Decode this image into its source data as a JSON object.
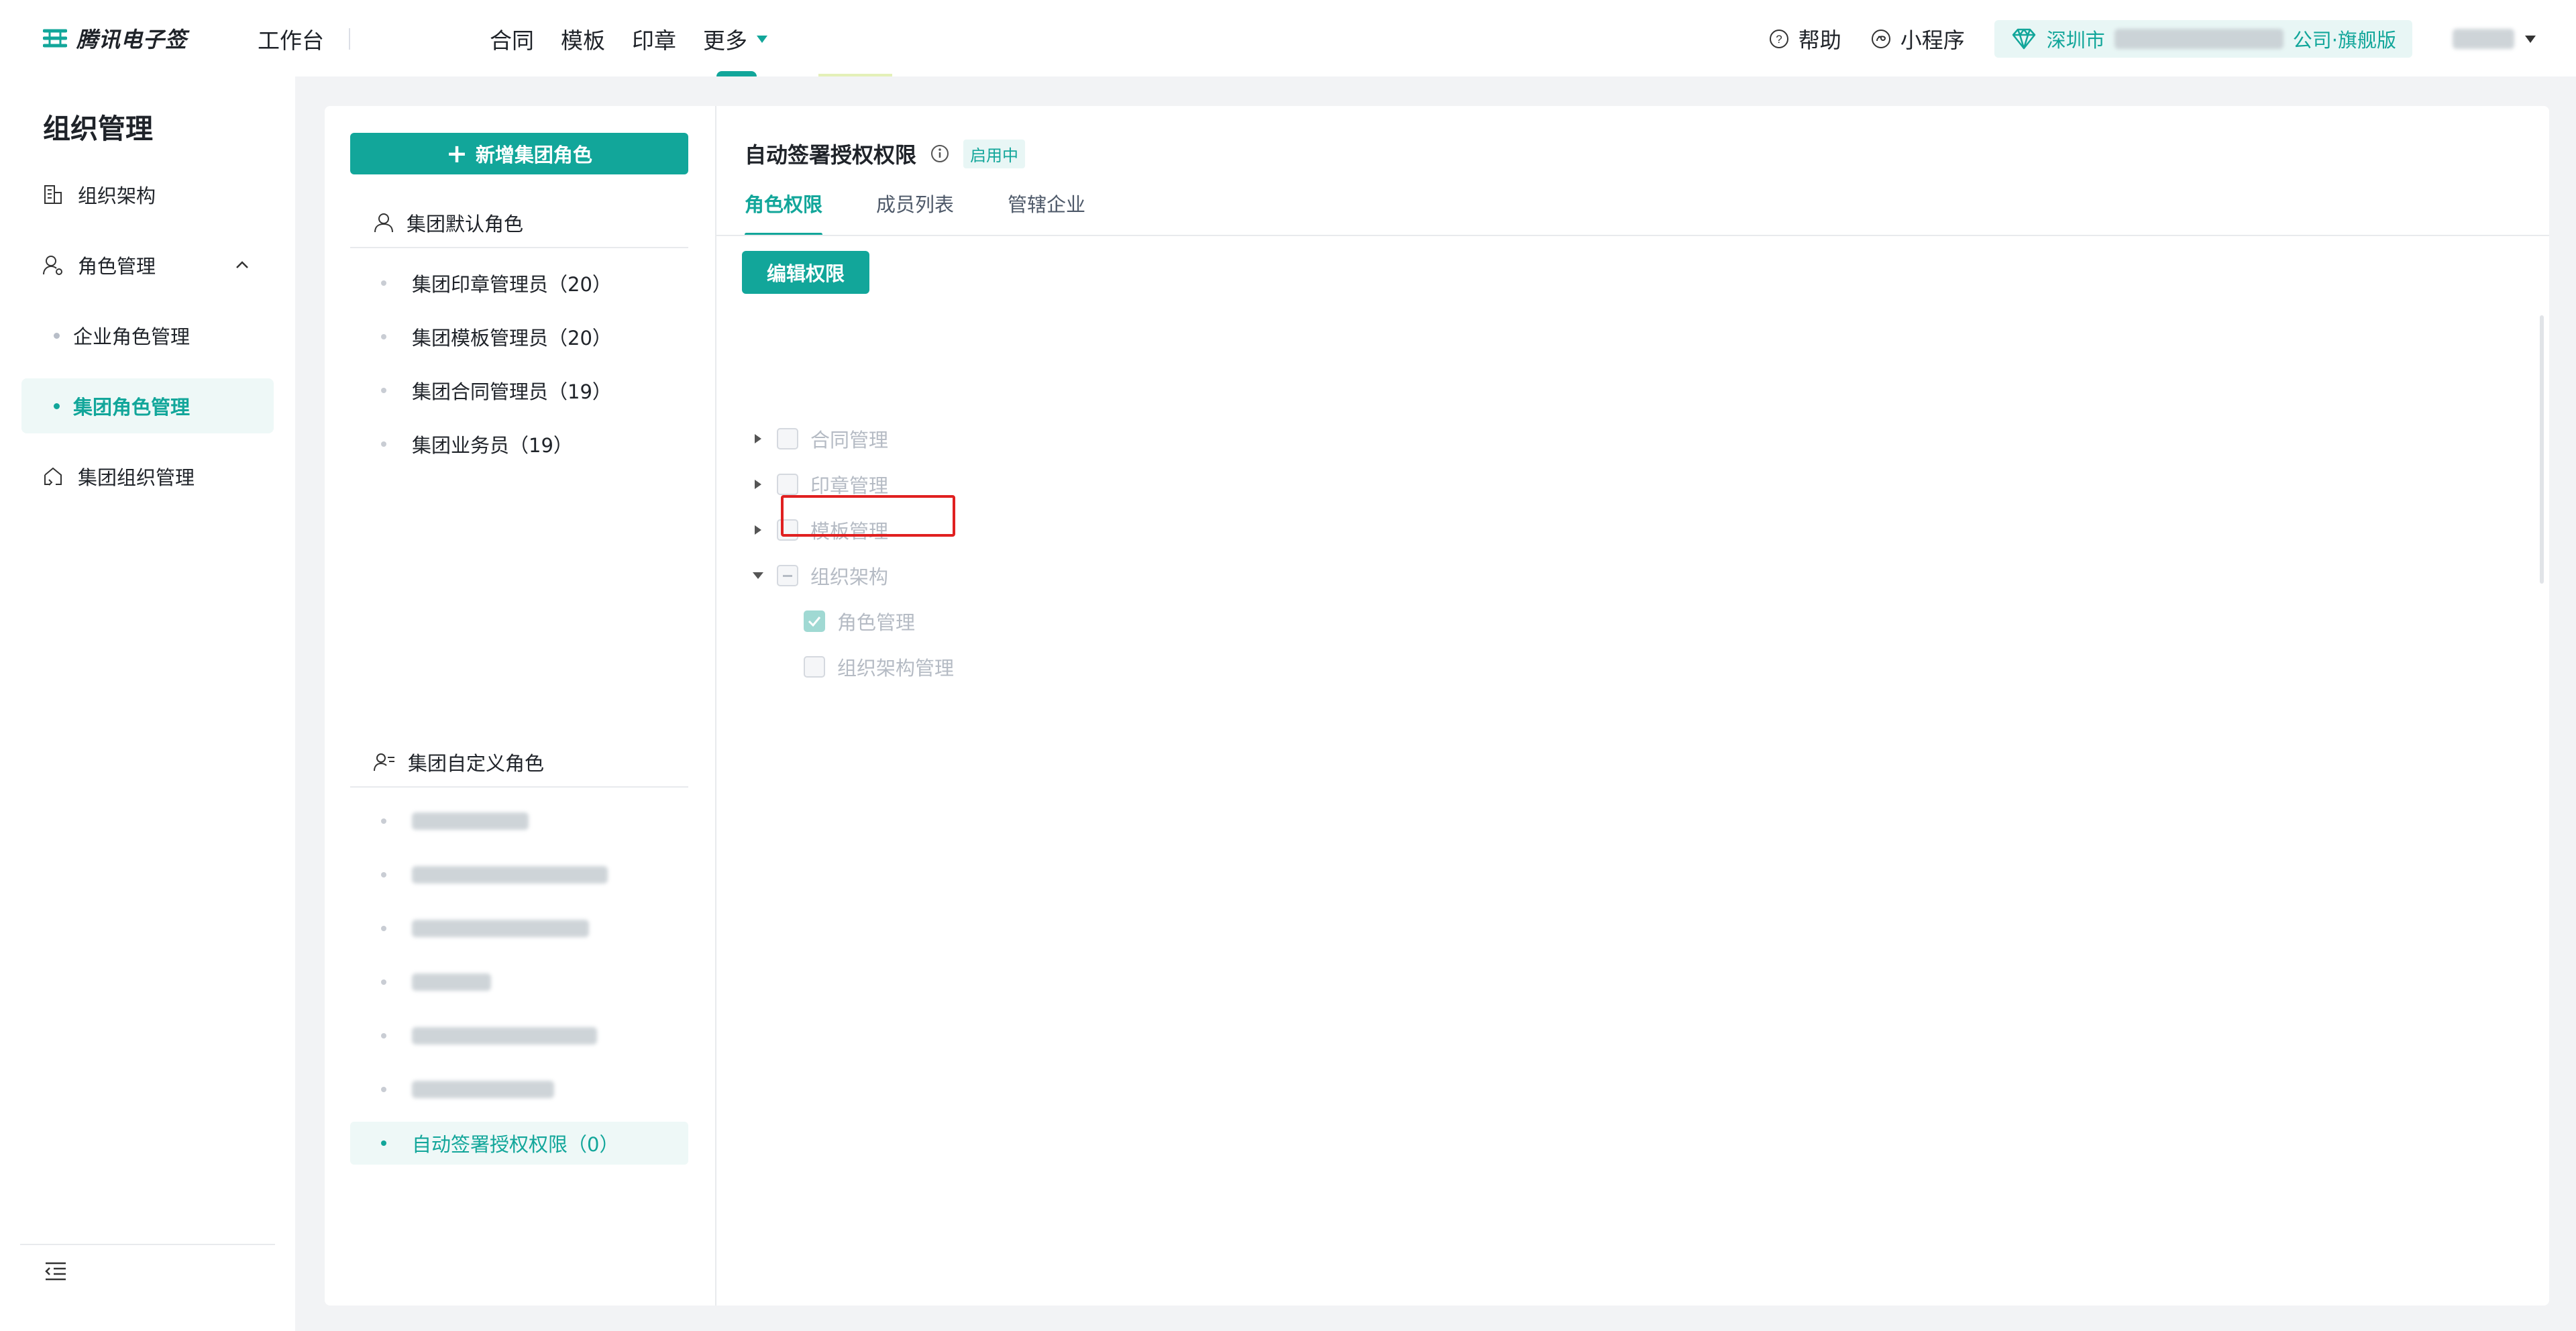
{
  "topbar": {
    "logo_text": "腾讯电子签",
    "workbench": "工作台",
    "nav": [
      "合同",
      "模板",
      "印章"
    ],
    "more": "更多",
    "help": "帮助",
    "miniprogram": "小程序",
    "org_prefix": "深圳市",
    "org_suffix": "公司·旗舰版"
  },
  "sidebar": {
    "title": "组织管理",
    "items": [
      "组织架构",
      "角色管理",
      "企业角色管理",
      "集团角色管理",
      "集团组织管理"
    ]
  },
  "roles": {
    "add_button": "新增集团角色",
    "default_group": "集团默认角色",
    "default_items": [
      "集团印章管理员（20）",
      "集团模板管理员（20）",
      "集团合同管理员（19）",
      "集团业务员（19）"
    ],
    "custom_group": "集团自定义角色",
    "active_item": "自动签署授权权限（0）"
  },
  "detail": {
    "title": "自动签署授权权限",
    "status": "启用中",
    "tabs": [
      "角色权限",
      "成员列表",
      "管辖企业"
    ],
    "edit_button": "编辑权限",
    "tree": [
      "合同管理",
      "印章管理",
      "模板管理",
      "组织架构",
      "角色管理",
      "组织架构管理"
    ]
  },
  "colors": {
    "accent": "#12a69a",
    "highlight": "#e02020"
  }
}
